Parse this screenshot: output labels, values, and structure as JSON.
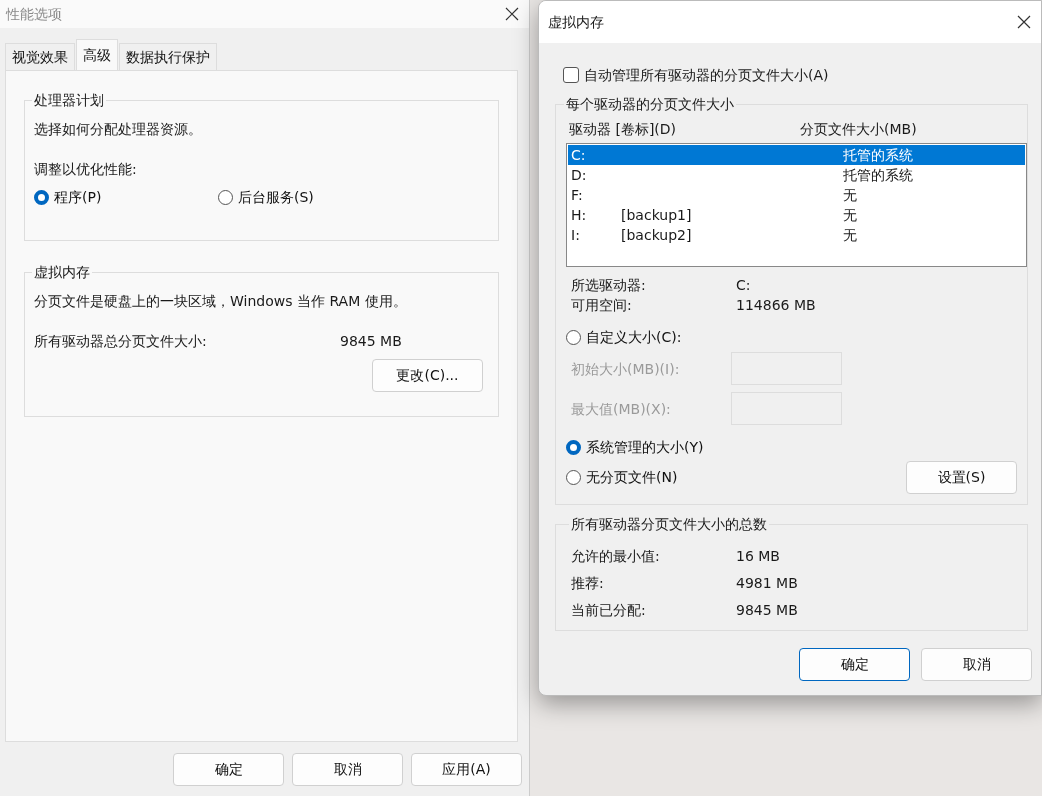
{
  "performance_window": {
    "title": "性能选项",
    "tabs": [
      {
        "label": "视觉效果",
        "selected": false
      },
      {
        "label": "高级",
        "selected": true
      },
      {
        "label": "数据执行保护",
        "selected": false
      }
    ],
    "processor_group": {
      "title": "处理器计划",
      "description": "选择如何分配处理器资源。",
      "adjust_label": "调整以优化性能:",
      "options": [
        {
          "label": "程序(P)",
          "selected": true
        },
        {
          "label": "后台服务(S)",
          "selected": false
        }
      ]
    },
    "virtual_memory_group": {
      "title": "虚拟内存",
      "description": "分页文件是硬盘上的一块区域，Windows 当作 RAM 使用。",
      "total_label": "所有驱动器总分页文件大小:",
      "total_value": "9845 MB",
      "change_button": "更改(C)..."
    },
    "buttons": [
      "确定",
      "取消",
      "应用(A)"
    ]
  },
  "virtual_memory_window": {
    "title": "虚拟内存",
    "auto_manage": {
      "label": "自动管理所有驱动器的分页文件大小(A)",
      "checked": false
    },
    "drives_group": {
      "title": "每个驱动器的分页文件大小",
      "columns": [
        "驱动器 [卷标](D)",
        "分页文件大小(MB)"
      ],
      "rows": [
        {
          "drive": "C:",
          "size": "托管的系统",
          "selected": true
        },
        {
          "drive": "D:",
          "size": "托管的系统",
          "selected": false
        },
        {
          "drive": "F:",
          "size": "无",
          "selected": false
        },
        {
          "drive": "H:",
          "volume": "[backup1]",
          "size": "无",
          "selected": false
        },
        {
          "drive": "I:",
          "volume": "[backup2]",
          "size": "无",
          "selected": false
        }
      ],
      "info": [
        {
          "label": "所选驱动器:",
          "value": "C:"
        },
        {
          "label": "可用空间:",
          "value": "114866 MB"
        }
      ],
      "size_options": [
        {
          "kind": "custom",
          "label": "自定义大小(C):",
          "selected": false,
          "fields": [
            {
              "label": "初始大小(MB)(I):",
              "disabled": true
            },
            {
              "label": "最大值(MB)(X):",
              "disabled": true
            }
          ]
        },
        {
          "kind": "plain",
          "label": "系统管理的大小(Y)",
          "selected": true
        },
        {
          "kind": "with_button",
          "label": "无分页文件(N)",
          "selected": false,
          "button": "设置(S)"
        }
      ]
    },
    "totals_group": {
      "title": "所有驱动器分页文件大小的总数",
      "rows": [
        {
          "label": "允许的最小值:",
          "value": "16 MB"
        },
        {
          "label": "推荐:",
          "value": "4981 MB"
        },
        {
          "label": "当前已分配:",
          "value": "9845 MB"
        }
      ]
    },
    "buttons": [
      {
        "label": "确定",
        "default": true
      },
      {
        "label": "取消",
        "default": false
      }
    ]
  }
}
